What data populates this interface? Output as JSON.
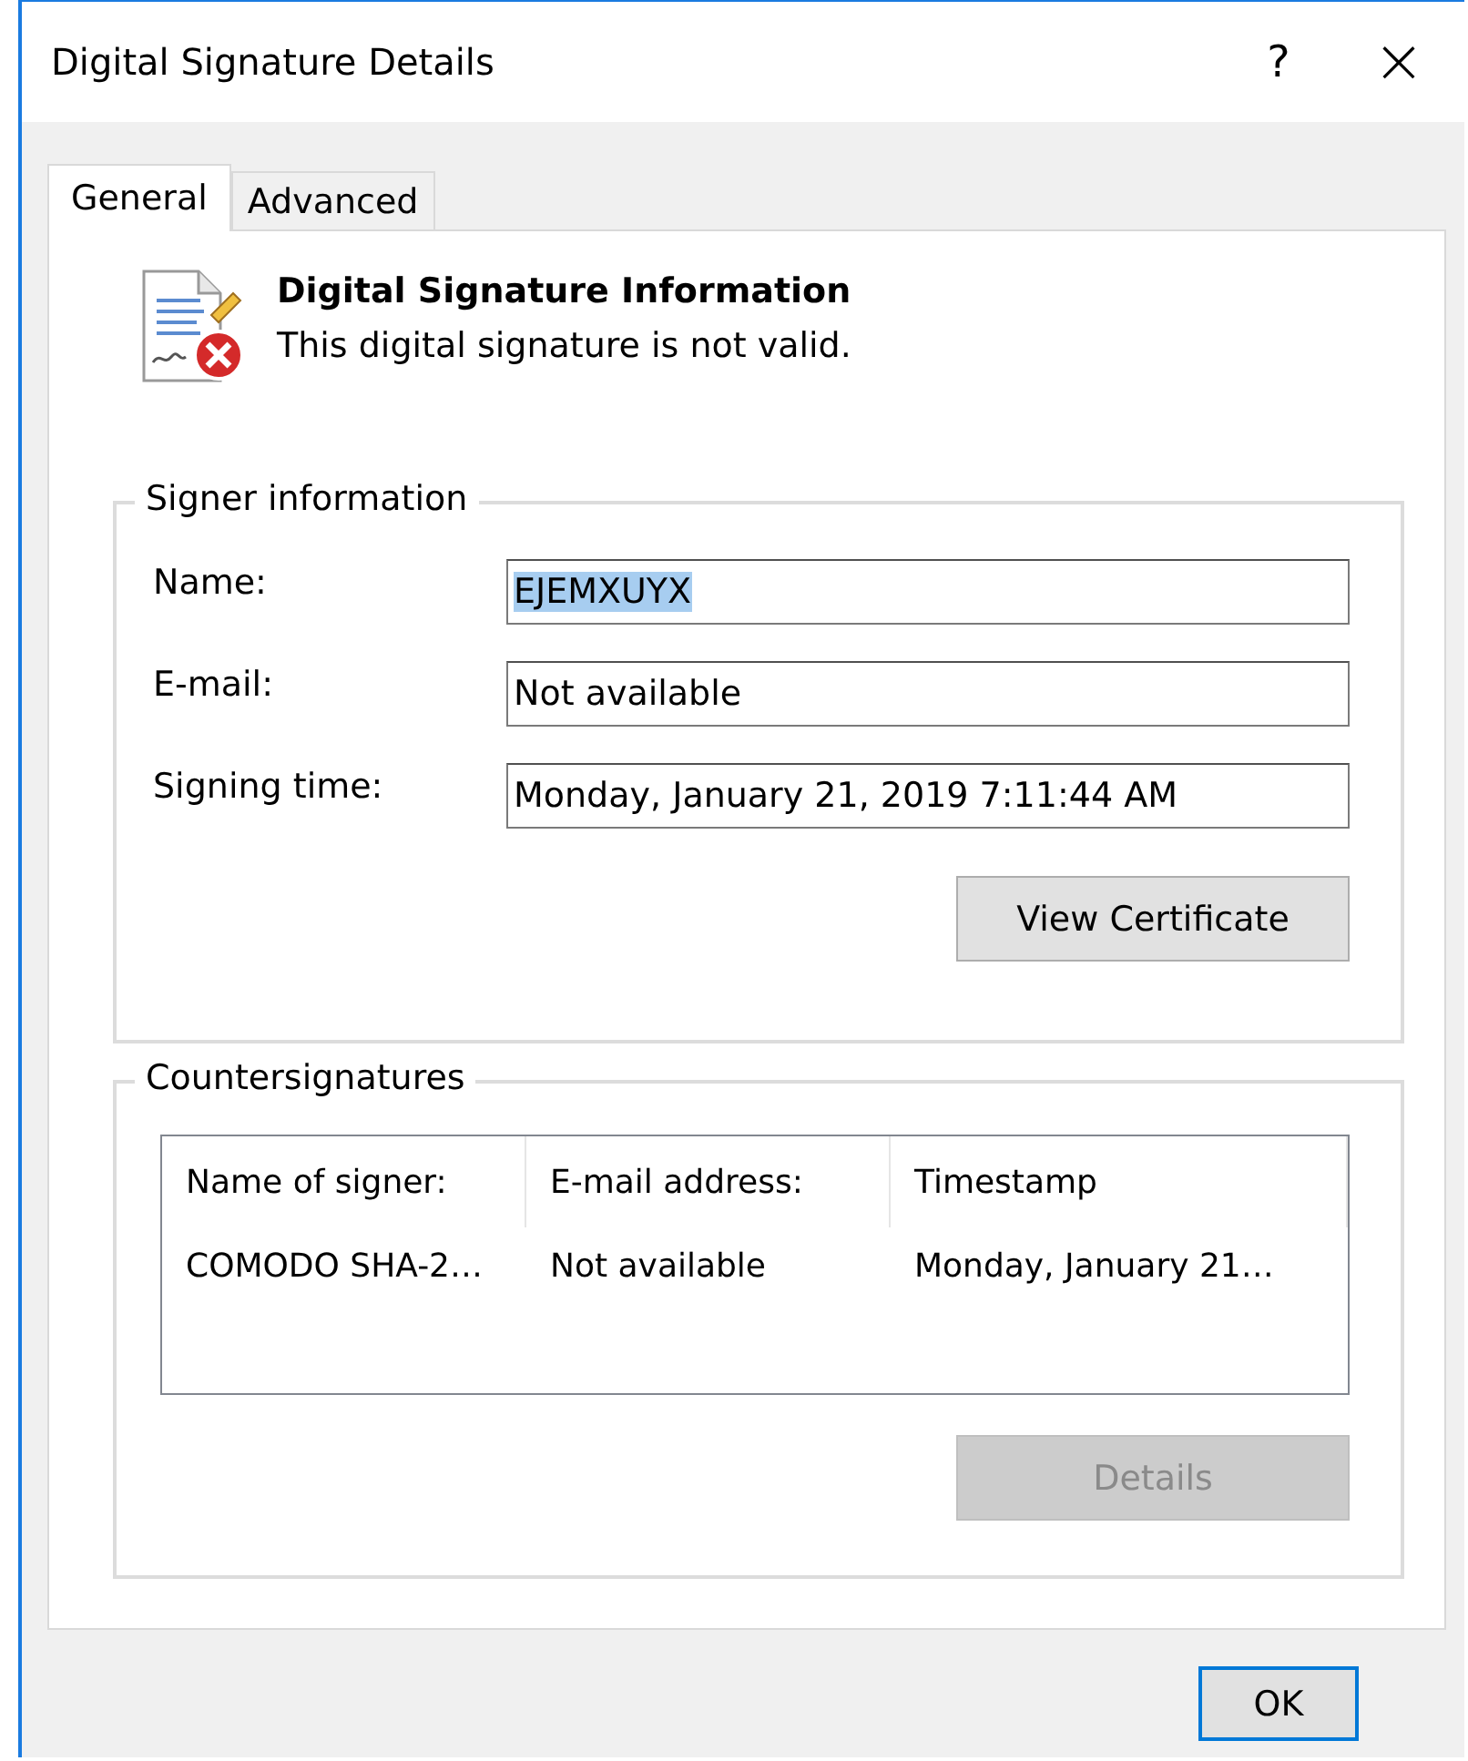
{
  "window": {
    "title": "Digital Signature Details",
    "help": "?",
    "close": "×"
  },
  "tabs": [
    {
      "label": "General",
      "selected": true
    },
    {
      "label": "Advanced",
      "selected": false
    }
  ],
  "header": {
    "title": "Digital Signature Information",
    "status": "This digital signature is not valid.",
    "valid": false
  },
  "signer": {
    "legend": "Signer information",
    "fields": [
      {
        "label": "Name:",
        "value": "EJEMXUYX",
        "selected": true
      },
      {
        "label": "E-mail:",
        "value": "Not available",
        "selected": false
      },
      {
        "label": "Signing time:",
        "value": "Monday, January 21, 2019 7:11:44 AM",
        "selected": false
      }
    ],
    "button": {
      "label": "View Certificate",
      "disabled": false
    }
  },
  "countersignatures": {
    "legend": "Countersignatures",
    "columns": [
      "Name of signer:",
      "E-mail address:",
      "Timestamp"
    ],
    "rows": [
      [
        "COMODO SHA-2…",
        "Not available",
        "Monday, January 21…"
      ]
    ],
    "button": {
      "label": "Details",
      "disabled": true
    }
  },
  "buttons": [
    {
      "label": "OK",
      "default": true
    }
  ]
}
